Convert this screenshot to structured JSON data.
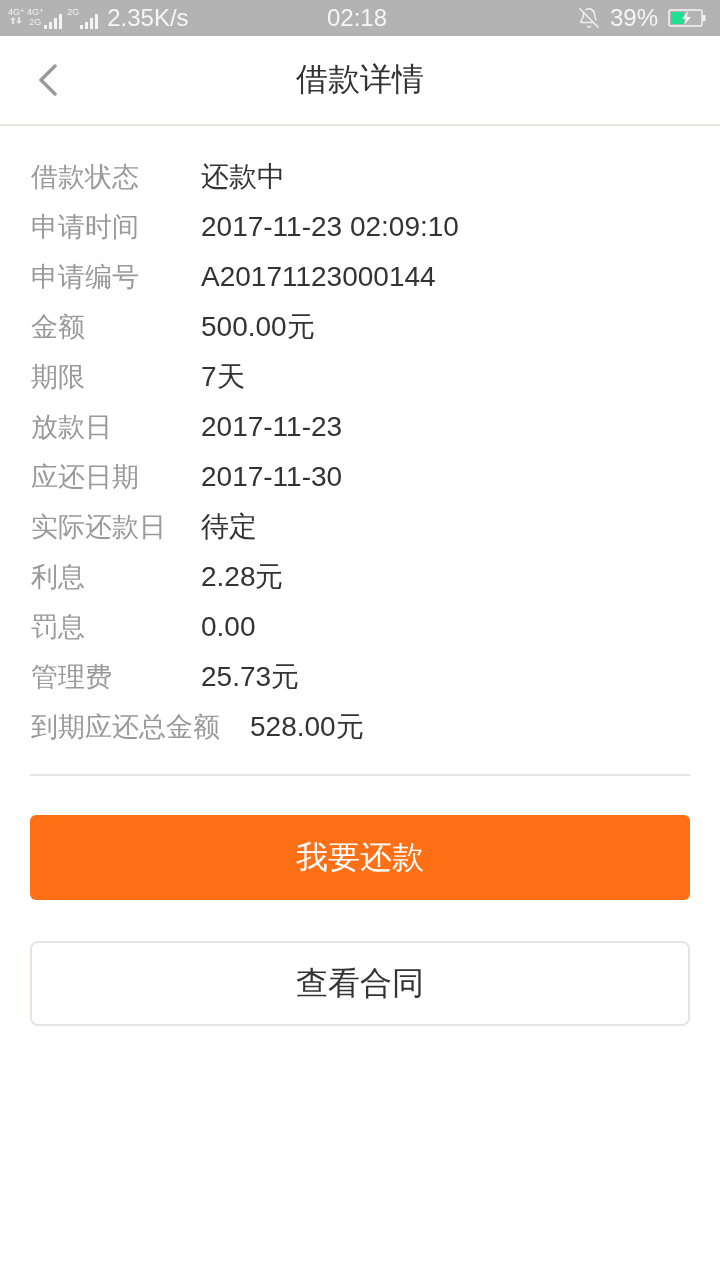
{
  "status_bar": {
    "indicators": [
      {
        "kind": "data",
        "label": "4G$^{+}$"
      },
      {
        "kind": "signal",
        "label": "4G$^{+}$",
        "sublabel": "2G"
      },
      {
        "kind": "signal",
        "label": "2G"
      }
    ],
    "speed": "2.35K/s",
    "time": "02:18",
    "silent": true,
    "battery": "39%",
    "charging": true
  },
  "header": {
    "title": "借款详情"
  },
  "details": [
    {
      "label": "借款状态",
      "value": "还款中"
    },
    {
      "label": "申请时间",
      "value": "2017-11-23 02:09:10"
    },
    {
      "label": "申请编号",
      "value": "A20171123000144"
    },
    {
      "label": "金额",
      "value": "500.00元"
    },
    {
      "label": "期限",
      "value": "7天"
    },
    {
      "label": "放款日",
      "value": "2017-11-23"
    },
    {
      "label": "应还日期",
      "value": "2017-11-30"
    },
    {
      "label": "实际还款日",
      "value": "待定"
    },
    {
      "label": "利息",
      "value": "2.28元"
    },
    {
      "label": "罚息",
      "value": "0.00"
    },
    {
      "label": "管理费",
      "value": "25.73元"
    },
    {
      "label": "到期应还总金额",
      "value": "528.00元"
    }
  ],
  "buttons": [
    {
      "label": "我要还款",
      "kind": "primary"
    },
    {
      "label": "查看合同",
      "kind": "secondary"
    }
  ]
}
